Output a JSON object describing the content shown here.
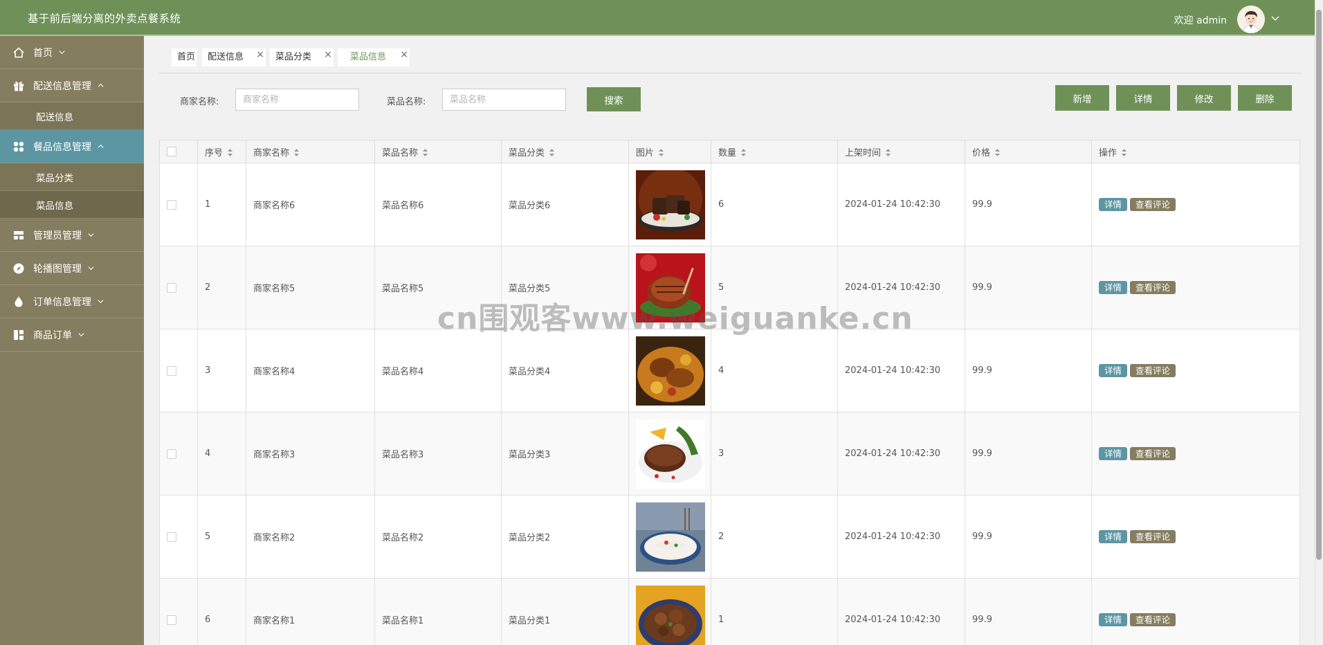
{
  "header": {
    "title": "基于前后端分离的外卖点餐系统",
    "welcome": "欢迎 admin"
  },
  "sidebar": {
    "items": [
      {
        "label": "首页",
        "icon": "home-icon"
      },
      {
        "label": "配送信息管理",
        "icon": "gift-icon",
        "submenu": [
          {
            "label": "配送信息"
          }
        ]
      },
      {
        "label": "餐品信息管理",
        "icon": "grid-icon",
        "submenu": [
          {
            "label": "菜品分类"
          },
          {
            "label": "菜品信息"
          }
        ]
      },
      {
        "label": "管理员管理",
        "icon": "layout-icon"
      },
      {
        "label": "轮播图管理",
        "icon": "compass-icon"
      },
      {
        "label": "订单信息管理",
        "icon": "drop-icon"
      },
      {
        "label": "商品订单",
        "icon": "dashboard-icon"
      }
    ]
  },
  "tabs": [
    {
      "label": "首页"
    },
    {
      "label": "配送信息"
    },
    {
      "label": "菜品分类"
    },
    {
      "label": "菜品信息"
    }
  ],
  "search": {
    "merchant_label": "商家名称:",
    "merchant_placeholder": "商家名称",
    "dish_label": "菜品名称:",
    "dish_placeholder": "菜品名称",
    "search_button": "搜索"
  },
  "toolbar": {
    "add": "新增",
    "detail": "详情",
    "edit": "修改",
    "delete": "删除"
  },
  "table": {
    "columns": [
      "序号",
      "商家名称",
      "菜品名称",
      "菜品分类",
      "图片",
      "数量",
      "上架时间",
      "价格",
      "操作"
    ],
    "rows": [
      {
        "index": "1",
        "merchant": "商家名称6",
        "dish": "菜品名称6",
        "category": "菜品分类6",
        "qty": "6",
        "time": "2024-01-24 10:42:30",
        "price": "99.9"
      },
      {
        "index": "2",
        "merchant": "商家名称5",
        "dish": "菜品名称5",
        "category": "菜品分类5",
        "qty": "5",
        "time": "2024-01-24 10:42:30",
        "price": "99.9"
      },
      {
        "index": "3",
        "merchant": "商家名称4",
        "dish": "菜品名称4",
        "category": "菜品分类4",
        "qty": "4",
        "time": "2024-01-24 10:42:30",
        "price": "99.9"
      },
      {
        "index": "4",
        "merchant": "商家名称3",
        "dish": "菜品名称3",
        "category": "菜品分类3",
        "qty": "3",
        "time": "2024-01-24 10:42:30",
        "price": "99.9"
      },
      {
        "index": "5",
        "merchant": "商家名称2",
        "dish": "菜品名称2",
        "category": "菜品分类2",
        "qty": "2",
        "time": "2024-01-24 10:42:30",
        "price": "99.9"
      },
      {
        "index": "6",
        "merchant": "商家名称1",
        "dish": "菜品名称1",
        "category": "菜品分类1",
        "qty": "1",
        "time": "2024-01-24 10:42:30",
        "price": "99.9"
      }
    ],
    "row_actions": {
      "detail": "详情",
      "comments": "查看评论"
    }
  },
  "watermark": "cn围观客www.weiguanke.cn",
  "colors": {
    "header": "#6f9158",
    "sidebar": "#857d5f",
    "active_menu": "#5c96a3",
    "action_button": "#6f9158"
  }
}
